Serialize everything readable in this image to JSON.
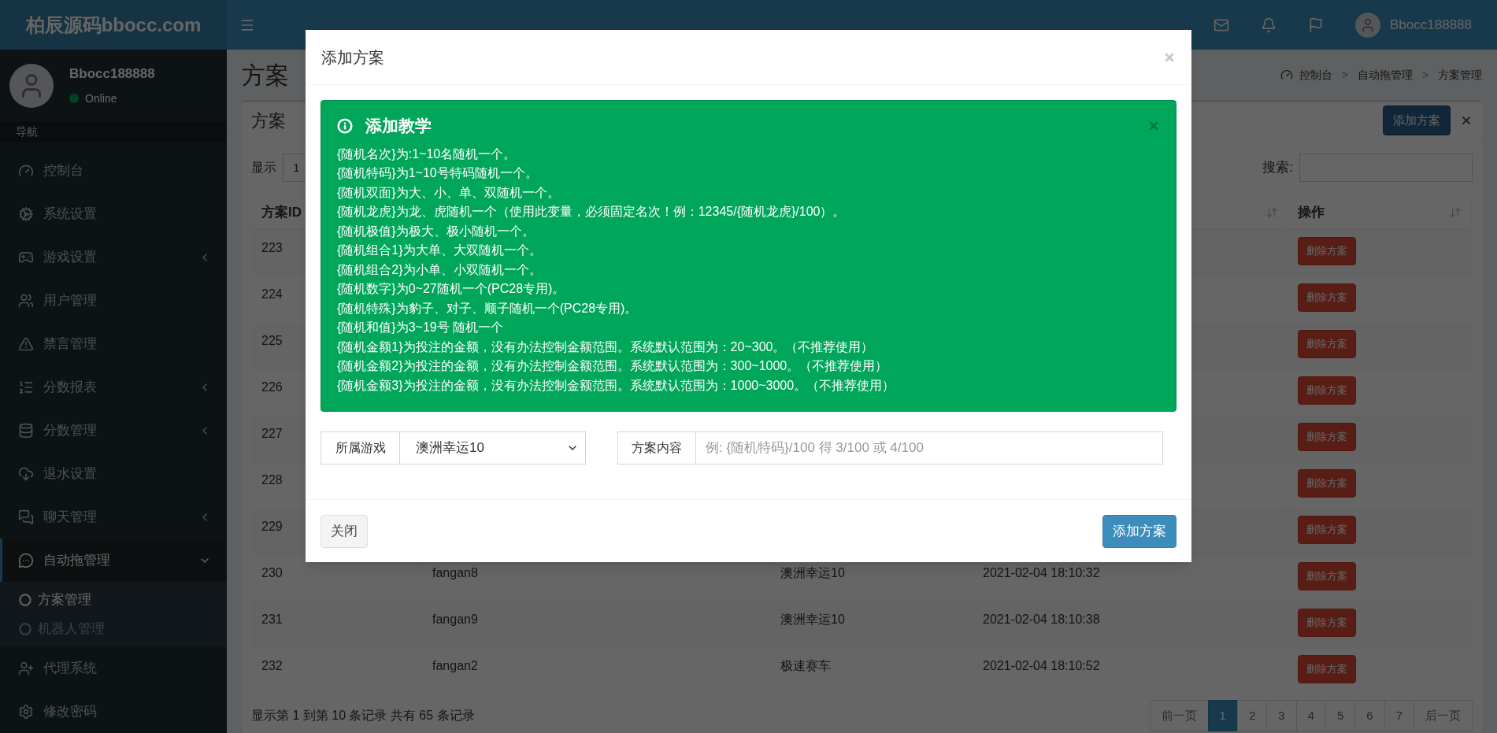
{
  "header": {
    "logo": "柏辰源码bbocc.com",
    "username": "Bbocc188888"
  },
  "sidebar": {
    "user": {
      "name": "Bbocc188888",
      "status": "Online"
    },
    "section_label": "导航",
    "items": [
      {
        "label": "控制台",
        "submenu": false,
        "expanded": false
      },
      {
        "label": "系统设置",
        "submenu": false,
        "expanded": false
      },
      {
        "label": "游戏设置",
        "submenu": true,
        "expanded": false
      },
      {
        "label": "用户管理",
        "submenu": false,
        "expanded": false
      },
      {
        "label": "禁言管理",
        "submenu": false,
        "expanded": false
      },
      {
        "label": "分数报表",
        "submenu": true,
        "expanded": false
      },
      {
        "label": "分数管理",
        "submenu": true,
        "expanded": false
      },
      {
        "label": "退水设置",
        "submenu": false,
        "expanded": false
      },
      {
        "label": "聊天管理",
        "submenu": true,
        "expanded": false
      },
      {
        "label": "自动拖管理",
        "submenu": true,
        "expanded": true,
        "children": [
          {
            "label": "方案管理",
            "selected": true
          },
          {
            "label": "机器人管理",
            "selected": false
          }
        ]
      },
      {
        "label": "代理系统",
        "submenu": false,
        "expanded": false
      },
      {
        "label": "修改密码",
        "submenu": false,
        "expanded": false
      }
    ]
  },
  "page": {
    "title": "方案",
    "breadcrumb": [
      "控制台",
      "自动拖管理",
      "方案管理"
    ],
    "breadcrumb_separators": [
      ">",
      ">"
    ]
  },
  "box": {
    "title": "方案",
    "add_button": "添加方案",
    "show_label": "显示",
    "page_length": "1",
    "search_label": "搜索:",
    "table": {
      "columns": [
        {
          "label": "方案ID"
        },
        {},
        {},
        {},
        {
          "label": "操作"
        }
      ],
      "rows": [
        {
          "id": "223",
          "action": "删除方案"
        },
        {
          "id": "224",
          "action": "删除方案"
        },
        {
          "id": "225",
          "action": "删除方案"
        },
        {
          "id": "226",
          "action": "删除方案"
        },
        {
          "id": "227",
          "action": "删除方案"
        },
        {
          "id": "228",
          "action": "删除方案"
        },
        {
          "id": "229",
          "action": "删除方案"
        },
        {
          "id": "230",
          "name": "fangan8",
          "game": "澳洲幸运10",
          "time": "2021-02-04 18:10:32",
          "action": "删除方案"
        },
        {
          "id": "231",
          "name": "fangan9",
          "game": "澳洲幸运10",
          "time": "2021-02-04 18:10:38",
          "action": "删除方案"
        },
        {
          "id": "232",
          "name": "fangan2",
          "game": "极速赛车",
          "time": "2021-02-04 18:10:52",
          "action": "删除方案"
        }
      ]
    },
    "info": "显示第 1 到第 10 条记录 共有 65 条记录",
    "pagination": [
      {
        "label": "前一页",
        "selected": false
      },
      {
        "label": "1",
        "selected": true
      },
      {
        "label": "2",
        "selected": false
      },
      {
        "label": "3",
        "selected": false
      },
      {
        "label": "4",
        "selected": false
      },
      {
        "label": "5",
        "selected": false
      },
      {
        "label": "6",
        "selected": false
      },
      {
        "label": "7",
        "selected": false
      },
      {
        "label": "后一页",
        "selected": false
      }
    ]
  },
  "modal": {
    "title": "添加方案",
    "alert": {
      "title": "添加教学",
      "lines": [
        "{随机名次}为:1~10名随机一个。",
        "{随机特码}为1~10号特码随机一个。",
        "{随机双面}为大、小、单、双随机一个。",
        "{随机龙虎}为龙、虎随机一个（使用此变量，必须固定名次！例：12345/{随机龙虎}/100）。",
        "{随机极值}为极大、极小随机一个。",
        "{随机组合1}为大单、大双随机一个。",
        "{随机组合2}为小单、小双随机一个。",
        "{随机数字}为0~27随机一个(PC28专用)。",
        "{随机特殊}为豹子、对子、顺子随机一个(PC28专用)。",
        "{随机和值}为3~19号 随机一个",
        "{随机金额1}为投注的金额，没有办法控制金额范围。系统默认范围为：20~300。（不推荐使用）",
        "{随机金额2}为投注的金额，没有办法控制金额范围。系统默认范围为：300~1000。（不推荐使用）",
        "{随机金额3}为投注的金额，没有办法控制金额范围。系统默认范围为：1000~3000。（不推荐使用）"
      ]
    },
    "game_label": "所属游戏",
    "game_value": "澳洲幸运10",
    "content_label": "方案内容",
    "content_placeholder": "例: {随机特码}/100 得 3/100 或 4/100",
    "buttons": [
      {
        "label": "关闭",
        "kind": "default"
      },
      {
        "label": "添加方案",
        "kind": "primary"
      }
    ]
  }
}
